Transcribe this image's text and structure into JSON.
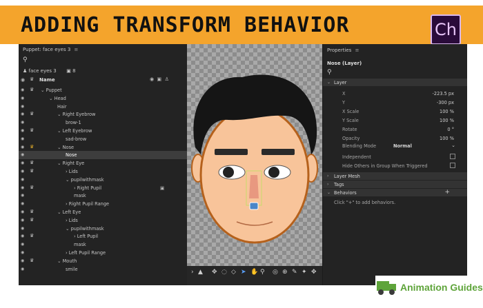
{
  "banner": {
    "title": "ADDING TRANSFORM BEHAVIOR",
    "app_logo": "Ch"
  },
  "puppet_panel": {
    "title": "Puppet: face eyes 3",
    "puppet_name": "face eyes 3",
    "puppet_count": "8",
    "name_header": "Name",
    "rows": [
      {
        "label": "Puppet",
        "indent": 0,
        "arrow": "⌄",
        "crown": true
      },
      {
        "label": "Head",
        "indent": 1,
        "arrow": "⌄",
        "crown": false
      },
      {
        "label": "Hair",
        "indent": 2,
        "arrow": "",
        "crown": false
      },
      {
        "label": "Right Eyebrow",
        "indent": 2,
        "arrow": "⌄",
        "crown": true
      },
      {
        "label": "brow-1",
        "indent": 3,
        "arrow": "",
        "crown": false
      },
      {
        "label": "Left Eyebrow",
        "indent": 2,
        "arrow": "⌄",
        "crown": true
      },
      {
        "label": "sad-brow",
        "indent": 3,
        "arrow": "",
        "crown": false
      },
      {
        "label": "Nose",
        "indent": 2,
        "arrow": "⌄",
        "crown": true,
        "gold": true
      },
      {
        "label": "Nose",
        "indent": 3,
        "arrow": "",
        "crown": false,
        "selected": true
      },
      {
        "label": "Right Eye",
        "indent": 2,
        "arrow": "⌄",
        "crown": true
      },
      {
        "label": "Lids",
        "indent": 3,
        "arrow": "›",
        "crown": true
      },
      {
        "label": "pupilwithmask",
        "indent": 3,
        "arrow": "⌄",
        "crown": false
      },
      {
        "label": "Right Pupil",
        "indent": 4,
        "arrow": "›",
        "crown": true,
        "extra": "▣"
      },
      {
        "label": "mask",
        "indent": 4,
        "arrow": "",
        "crown": false
      },
      {
        "label": "Right Pupil Range",
        "indent": 3,
        "arrow": "›",
        "crown": false
      },
      {
        "label": "Left Eye",
        "indent": 2,
        "arrow": "⌄",
        "crown": true
      },
      {
        "label": "Lids",
        "indent": 3,
        "arrow": "›",
        "crown": true
      },
      {
        "label": "pupilwithmask",
        "indent": 3,
        "arrow": "⌄",
        "crown": false
      },
      {
        "label": "Left Pupil",
        "indent": 4,
        "arrow": "›",
        "crown": true
      },
      {
        "label": "mask",
        "indent": 4,
        "arrow": "",
        "crown": false
      },
      {
        "label": "Left Pupil Range",
        "indent": 3,
        "arrow": "›",
        "crown": false
      },
      {
        "label": "Mouth",
        "indent": 2,
        "arrow": "⌄",
        "crown": true
      },
      {
        "label": "smile",
        "indent": 3,
        "arrow": "",
        "crown": false
      }
    ]
  },
  "properties": {
    "title": "Properties",
    "layer_title": "Nose (Layer)",
    "layer_section": "Layer",
    "fields": [
      {
        "label": "X",
        "value": "-223.5 px"
      },
      {
        "label": "Y",
        "value": "-300 px"
      },
      {
        "label": "X Scale",
        "value": "100 %"
      },
      {
        "label": "Y Scale",
        "value": "100 %"
      },
      {
        "label": "Rotate",
        "value": "0 °"
      },
      {
        "label": "Opacity",
        "value": "100 %"
      }
    ],
    "blending_label": "Blending Mode",
    "blending_value": "Normal",
    "independent_label": "Independent",
    "hide_others_label": "Hide Others in Group When Triggered",
    "layer_mesh": "Layer Mesh",
    "tags": "Tags",
    "behaviors": "Behaviors",
    "add_hint": "Click \"+\" to add behaviors."
  },
  "footer": {
    "brand": "Animation Guides"
  },
  "colors": {
    "banner": "#f4a42c",
    "brand_green": "#5ea43a",
    "skin": "#f8c49a"
  }
}
